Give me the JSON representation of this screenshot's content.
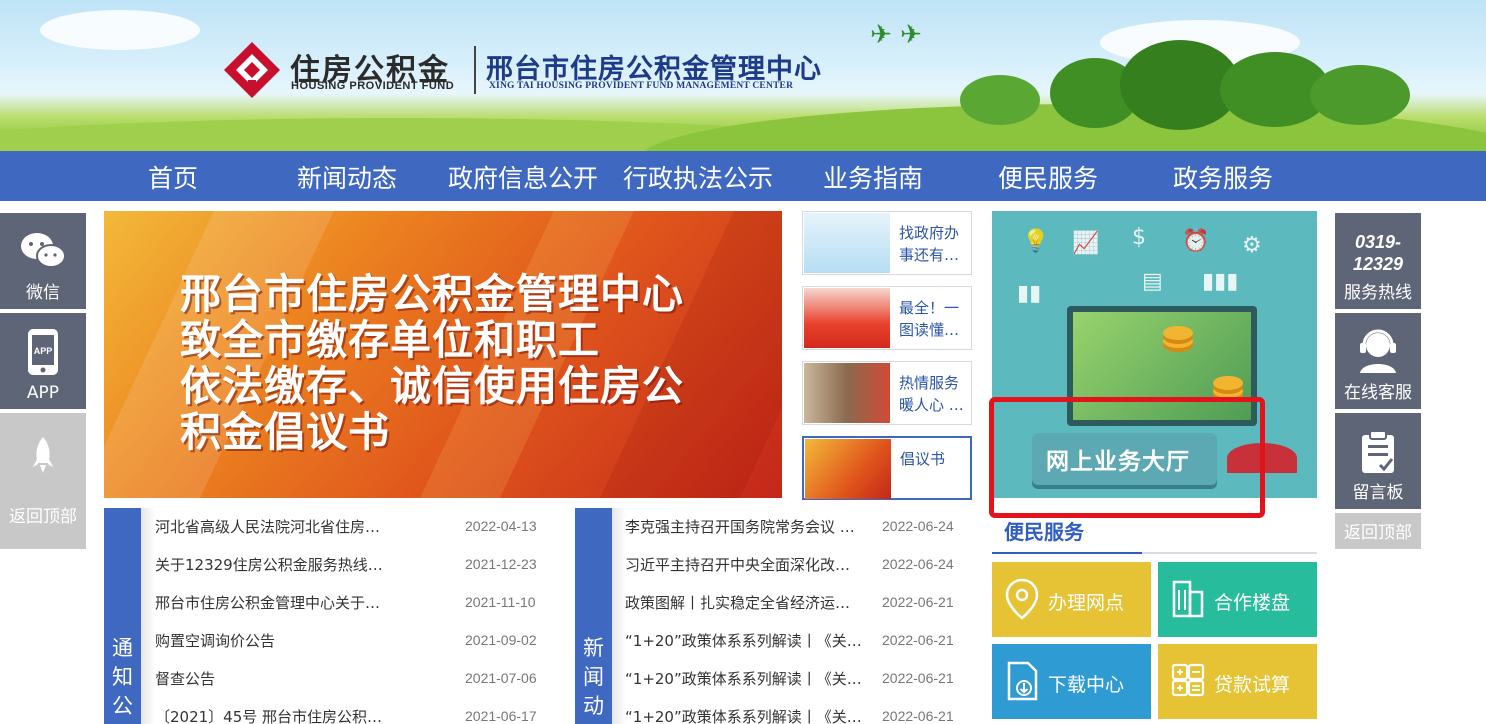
{
  "header": {
    "logo_cn": "住房公积金",
    "logo_en": "HOUSING PROVIDENT FUND",
    "center_cn": "邢台市住房公积金管理中心",
    "center_en": "XING TAI HOUSING PROVIDENT FUND MANAGEMENT CENTER"
  },
  "nav": {
    "items": [
      "首页",
      "新闻动态",
      "政府信息公开",
      "行政执法公示",
      "业务指南",
      "便民服务",
      "政务服务"
    ]
  },
  "left_float": {
    "wechat": "微信",
    "app": "APP",
    "app_icon_text": "APP",
    "back_top": "返回顶部"
  },
  "right_float": {
    "hotline_number_1": "0319-",
    "hotline_number_2": "12329",
    "hotline": "服务热线",
    "online_service": "在线客服",
    "message_board": "留言板",
    "back_top": "返回顶部"
  },
  "banner": {
    "lines": [
      "邢台市住房公积金管理中心",
      "致全市缴存单位和职工",
      "依法缴存、诚信使用住房公",
      "积金倡议书"
    ]
  },
  "thumbs": [
    {
      "text": "找政府办事还有…"
    },
    {
      "text": "最全！一图读懂…"
    },
    {
      "text": "热情服务暖人心 …"
    },
    {
      "text": "倡议书"
    }
  ],
  "hall": {
    "button": "网上业务大厅"
  },
  "services": {
    "title": "便民服务",
    "tiles": [
      {
        "label": "办理网点",
        "color": "#e6c334",
        "icon": "location-pin-icon"
      },
      {
        "label": "合作楼盘",
        "color": "#27bd9c",
        "icon": "building-icon"
      },
      {
        "label": "下载中心",
        "color": "#2f9bd3",
        "icon": "download-file-icon"
      },
      {
        "label": "贷款试算",
        "color": "#e6c334",
        "icon": "calculator-icon"
      }
    ]
  },
  "notice": {
    "tab": [
      "通",
      "知",
      "公"
    ],
    "items": [
      {
        "title": "河北省高级人民法院河北省住房…",
        "date": "2022-04-13"
      },
      {
        "title": "关于12329住房公积金服务热线…",
        "date": "2021-12-23"
      },
      {
        "title": "邢台市住房公积金管理中心关于…",
        "date": "2021-11-10"
      },
      {
        "title": "购置空调询价公告",
        "date": "2021-09-02"
      },
      {
        "title": "督查公告",
        "date": "2021-07-06"
      },
      {
        "title": "〔2021〕45号 邢台市住房公积…",
        "date": "2021-06-17"
      }
    ]
  },
  "news": {
    "tab": [
      "新",
      "闻",
      "动"
    ],
    "items": [
      {
        "title": "李克强主持召开国务院常务会议 …",
        "date": "2022-06-24"
      },
      {
        "title": "习近平主持召开中央全面深化改…",
        "date": "2022-06-24"
      },
      {
        "title": "政策图解丨扎实稳定全省经济运…",
        "date": "2022-06-21"
      },
      {
        "title": "“1+20”政策体系系列解读丨《关…",
        "date": "2022-06-21"
      },
      {
        "title": "“1+20”政策体系系列解读丨《关…",
        "date": "2022-06-21"
      },
      {
        "title": "“1+20”政策体系系列解读丨《关…",
        "date": "2022-06-21"
      }
    ]
  }
}
